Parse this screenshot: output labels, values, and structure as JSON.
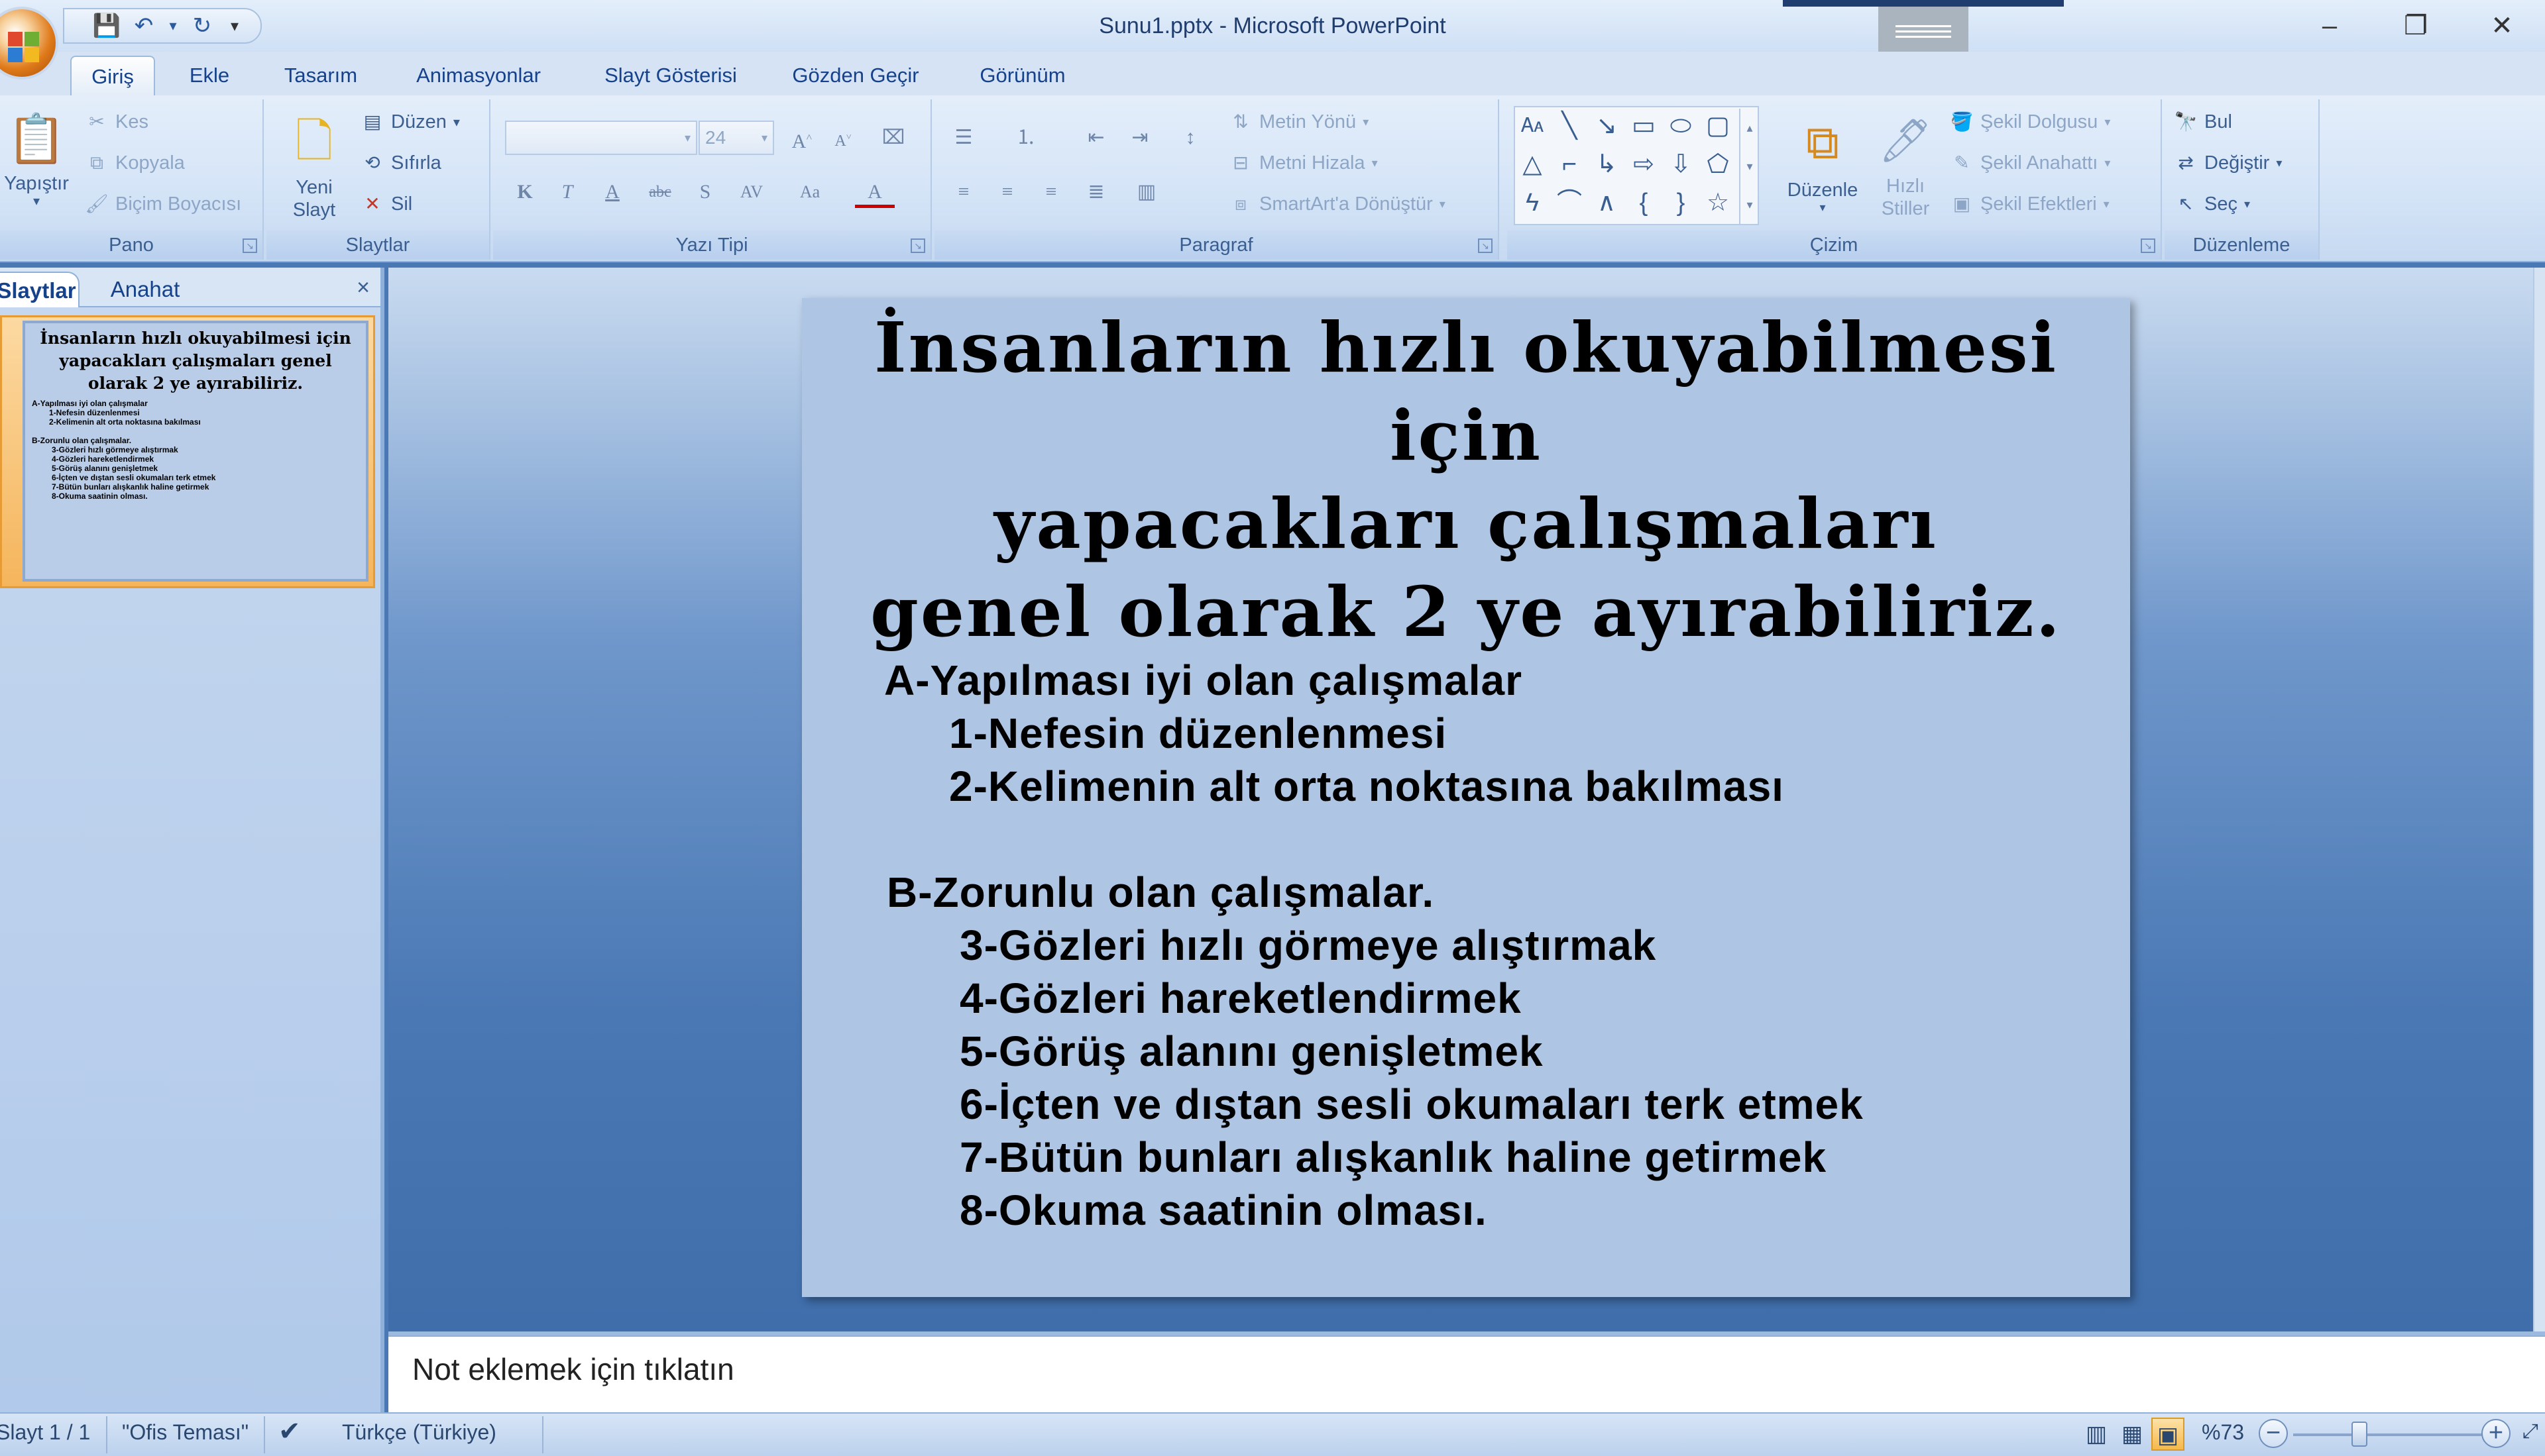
{
  "window": {
    "title": "Sunu1.pptx - Microsoft PowerPoint",
    "minimize": "–",
    "restore": "❐",
    "close": "✕"
  },
  "qat": {
    "save": "💾",
    "undo": "↶",
    "undo_dropdown": "▾",
    "redo": "↻",
    "customize": "▾"
  },
  "tabs": [
    "Giriş",
    "Ekle",
    "Tasarım",
    "Animasyonlar",
    "Slayt Gösterisi",
    "Gözden Geçir",
    "Görünüm"
  ],
  "ribbon": {
    "pano": {
      "label": "Pano",
      "paste": "Yapıştır",
      "cut": "Kes",
      "copy": "Kopyala",
      "format_painter": "Biçim Boyacısı"
    },
    "slaytlar": {
      "label": "Slaytlar",
      "new_slide_1": "Yeni",
      "new_slide_2": "Slayt",
      "layout": "Düzen",
      "reset": "Sıfırla",
      "delete": "Sil"
    },
    "yazi_tipi": {
      "label": "Yazı Tipi",
      "font_name": "",
      "font_size": "24",
      "bold": "K",
      "italic": "T",
      "underline": "A",
      "strike": "abc",
      "shadow": "S",
      "spacing": "AV",
      "case": "Aa",
      "color": "A"
    },
    "paragraf": {
      "label": "Paragraf",
      "text_direction": "Metin Yönü",
      "align_text": "Metni Hizala",
      "smartart": "SmartArt'a Dönüştür"
    },
    "cizim": {
      "label": "Çizim",
      "arrange": "Düzenle",
      "quick_styles_1": "Hızlı",
      "quick_styles_2": "Stiller",
      "shape_fill": "Şekil Dolgusu",
      "shape_outline": "Şekil Anahattı",
      "shape_effects": "Şekil Efektleri"
    },
    "duzenleme": {
      "label": "Düzenleme",
      "find": "Bul",
      "replace": "Değiştir",
      "select": "Seç"
    }
  },
  "left_pane": {
    "tab_slides": "Slaytlar",
    "tab_outline": "Anahat",
    "close": "×",
    "thumb_title": "İnsanların hızlı okuyabilmesi için yapacakları çalışmaları genel olarak 2 ye ayırabiliriz.",
    "thumb_lines": [
      "A-Yapılması iyi olan çalışmalar",
      "1-Nefesin düzenlenmesi",
      "2-Kelimenin alt orta noktasına bakılması",
      "",
      "B-Zorunlu olan çalışmalar.",
      "3-Gözleri hızlı görmeye alıştırmak",
      "4-Gözleri hareketlendirmek",
      "5-Görüş alanını genişletmek",
      "6-İçten ve dıştan sesli okumaları terk etmek",
      "7-Bütün bunları alışkanlık haline getirmek",
      "8-Okuma saatinin olması."
    ]
  },
  "slide": {
    "title_line1": "İnsanların hızlı okuyabilmesi için",
    "title_line2": "yapacakları çalışmaları",
    "title_line3": "genel olarak 2 ye ayırabiliriz.",
    "section_a": "A-Yapılması iyi olan çalışmalar",
    "a1": "1-Nefesin düzenlenmesi",
    "a2": "2-Kelimenin alt orta noktasına bakılması",
    "section_b": "B-Zorunlu olan çalışmalar.",
    "b3": "3-Gözleri hızlı görmeye alıştırmak",
    "b4": "4-Gözleri hareketlendirmek",
    "b5": "5-Görüş alanını genişletmek",
    "b6": "6-İçten ve dıştan sesli okumaları terk etmek",
    "b7": "7-Bütün bunları alışkanlık haline getirmek",
    "b8": "8-Okuma saatinin olması."
  },
  "notes": {
    "placeholder": "Not eklemek için tıklatın"
  },
  "status": {
    "slide_counter": "Slayt 1 / 1",
    "theme": "\"Ofis Teması\"",
    "language": "Türkçe (Türkiye)",
    "zoom": "%73",
    "zoom_out": "−",
    "zoom_in": "+"
  }
}
